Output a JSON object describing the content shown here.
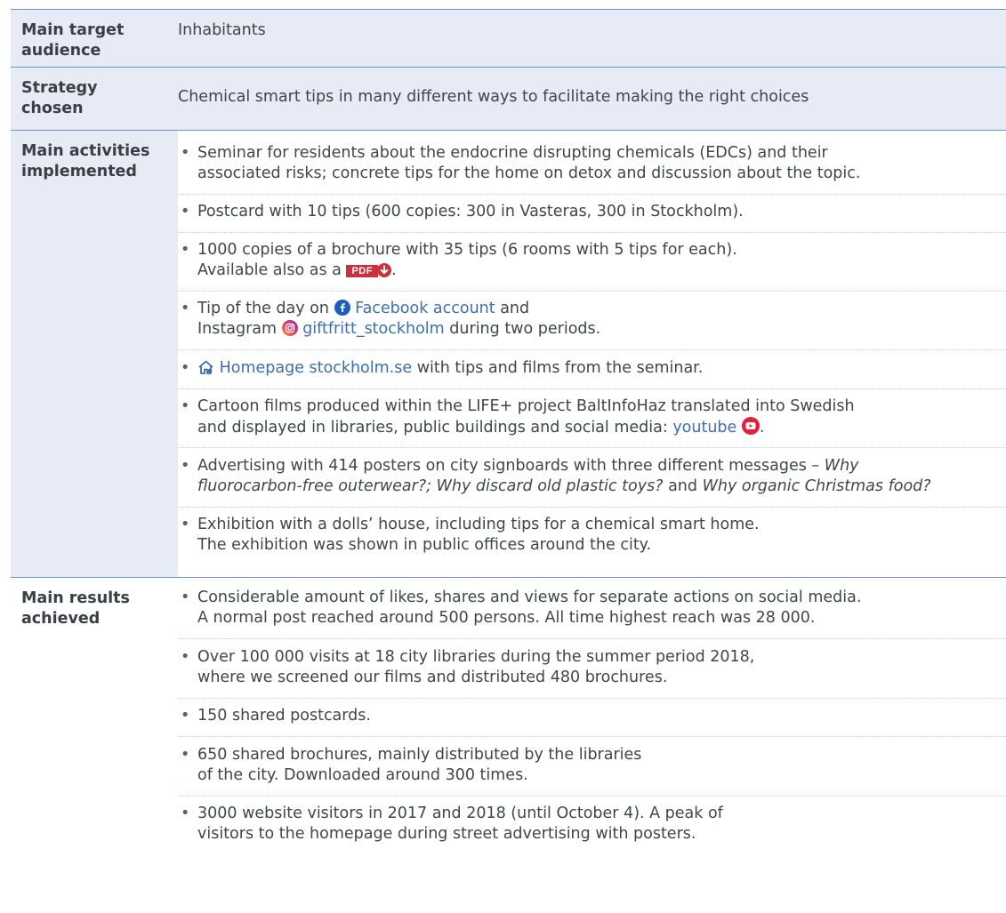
{
  "rows": [
    {
      "label": "Main target audience",
      "text": "Inhabitants"
    },
    {
      "label": "Strategy chosen",
      "text": "Chemical smart tips in many different ways to facilitate making the right choices"
    },
    {
      "label": "Main activities implemented",
      "items": {
        "seminar": [
          "Seminar for residents about the endocrine disrupting chemicals (EDCs) and their",
          "associated risks; concrete tips for the home on detox and discussion about the topic."
        ],
        "postcard": "Postcard with 10 tips (600 copies: 300 in Vasteras, 300 in Stockholm).",
        "brochure_1": "1000 copies of a brochure with 35 tips (6 rooms with 5 tips for each).",
        "brochure_2": "Available also as a",
        "pdf_label": "PDF",
        "tip_1": "Tip of the day on",
        "facebook_link": "Facebook account",
        "tip_2": "and",
        "tip_3": "Instagram",
        "instagram_link": "giftfritt_stockholm",
        "tip_4": "during two periods.",
        "homepage_link": "Homepage stockholm.se",
        "homepage_rest": "with tips and films from the seminar.",
        "cartoon_1": "Cartoon films produced within the LIFE+ project BaltInfoHaz translated into Swedish",
        "cartoon_2": "and displayed in libraries, public buildings and social media:",
        "youtube_link": "youtube",
        "adv_1": "Advertising with 414 posters on city signboards with three different messages –",
        "adv_1_italic": "Why",
        "adv_2_italic_a": "fluorocarbon-free outerwear?; Why discard old plastic toys?",
        "adv_2_and": "and",
        "adv_2_italic_b": "Why organic Christmas food?",
        "exhibit": [
          "Exhibition with a dolls’ house, including tips for a chemical smart home.",
          "The exhibition was shown in public offices around the city."
        ]
      }
    },
    {
      "label": "Main results achieved",
      "results": [
        [
          "Considerable amount of likes, shares and views for separate actions on social media.",
          "A normal post reached around 500 persons. All time highest reach was 28 000."
        ],
        [
          "Over 100 000 visits at 18 city libraries during the summer period 2018,",
          "where we screened our films and distributed 480 brochures."
        ],
        [
          "150 shared postcards."
        ],
        [
          "650 shared brochures, mainly distributed by the libraries",
          "of the city. Downloaded around 300 times."
        ],
        [
          "3000 website visitors in 2017 and 2018 (until October 4). A peak of",
          "visitors to the homepage during street advertising with posters."
        ]
      ]
    }
  ],
  "colors": {
    "header_bg": "#e6ebf5",
    "rule": "#6f93b8",
    "link": "#3d6fae",
    "pdf": "#c9323a",
    "facebook": "#1d5fb8",
    "youtube": "#e2203a"
  }
}
